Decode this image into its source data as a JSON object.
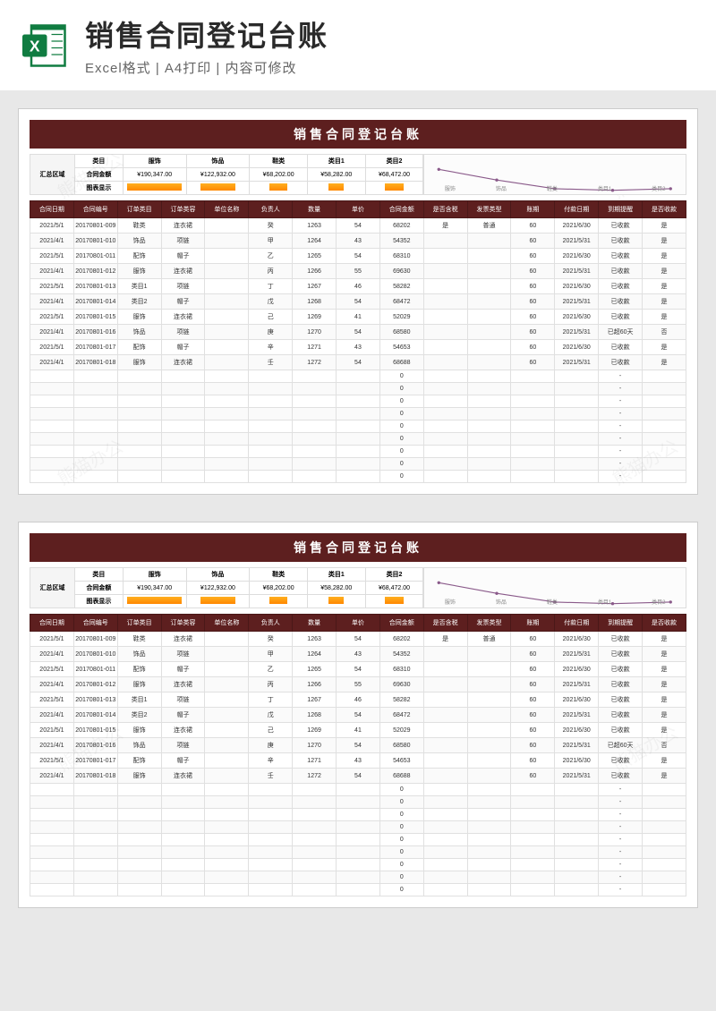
{
  "header": {
    "title": "销售合同登记台账",
    "subtitle": "Excel格式 | A4打印 | 内容可修改"
  },
  "sheet": {
    "title": "销售合同登记台账",
    "summary_label": "汇总区域",
    "summary_rows": [
      "类目",
      "合同金额",
      "图表显示"
    ],
    "categories": [
      {
        "name": "服饰",
        "amount": "¥190,347.00",
        "bar": 95
      },
      {
        "name": "饰品",
        "amount": "¥122,932.00",
        "bar": 62
      },
      {
        "name": "鞋类",
        "amount": "¥68,202.00",
        "bar": 35
      },
      {
        "name": "类目1",
        "amount": "¥58,282.00",
        "bar": 30
      },
      {
        "name": "类目2",
        "amount": "¥68,472.00",
        "bar": 35
      }
    ],
    "chart_labels": [
      "服饰",
      "饰品",
      "鞋类",
      "类目1",
      "类目2"
    ],
    "columns": [
      "合同日期",
      "合同编号",
      "订单类目",
      "订单类容",
      "单位名称",
      "负责人",
      "数量",
      "单价",
      "合同金额",
      "是否含税",
      "发票类型",
      "账期",
      "付款日期",
      "到期提醒",
      "是否收款"
    ],
    "rows": [
      [
        "2021/5/1",
        "20170801-009",
        "鞋类",
        "连衣裙",
        "",
        "癸",
        "1263",
        "54",
        "68202",
        "是",
        "普通",
        "60",
        "2021/6/30",
        "已收款",
        "是"
      ],
      [
        "2021/4/1",
        "20170801-010",
        "饰品",
        "项链",
        "",
        "甲",
        "1264",
        "43",
        "54352",
        "",
        "",
        "60",
        "2021/5/31",
        "已收款",
        "是"
      ],
      [
        "2021/5/1",
        "20170801-011",
        "配饰",
        "帽子",
        "",
        "乙",
        "1265",
        "54",
        "68310",
        "",
        "",
        "60",
        "2021/6/30",
        "已收款",
        "是"
      ],
      [
        "2021/4/1",
        "20170801-012",
        "服饰",
        "连衣裙",
        "",
        "丙",
        "1266",
        "55",
        "69630",
        "",
        "",
        "60",
        "2021/5/31",
        "已收款",
        "是"
      ],
      [
        "2021/5/1",
        "20170801-013",
        "类目1",
        "项链",
        "",
        "丁",
        "1267",
        "46",
        "58282",
        "",
        "",
        "60",
        "2021/6/30",
        "已收款",
        "是"
      ],
      [
        "2021/4/1",
        "20170801-014",
        "类目2",
        "帽子",
        "",
        "戊",
        "1268",
        "54",
        "68472",
        "",
        "",
        "60",
        "2021/5/31",
        "已收款",
        "是"
      ],
      [
        "2021/5/1",
        "20170801-015",
        "服饰",
        "连衣裙",
        "",
        "己",
        "1269",
        "41",
        "52029",
        "",
        "",
        "60",
        "2021/6/30",
        "已收款",
        "是"
      ],
      [
        "2021/4/1",
        "20170801-016",
        "饰品",
        "项链",
        "",
        "庚",
        "1270",
        "54",
        "68580",
        "",
        "",
        "60",
        "2021/5/31",
        "已超60天",
        "否"
      ],
      [
        "2021/5/1",
        "20170801-017",
        "配饰",
        "帽子",
        "",
        "辛",
        "1271",
        "43",
        "54653",
        "",
        "",
        "60",
        "2021/6/30",
        "已收款",
        "是"
      ],
      [
        "2021/4/1",
        "20170801-018",
        "服饰",
        "连衣裙",
        "",
        "壬",
        "1272",
        "54",
        "68688",
        "",
        "",
        "60",
        "2021/5/31",
        "已收款",
        "是"
      ],
      [
        "",
        "",
        "",
        "",
        "",
        "",
        "",
        "",
        "0",
        "",
        "",
        "",
        "",
        "-",
        ""
      ],
      [
        "",
        "",
        "",
        "",
        "",
        "",
        "",
        "",
        "0",
        "",
        "",
        "",
        "",
        "-",
        ""
      ],
      [
        "",
        "",
        "",
        "",
        "",
        "",
        "",
        "",
        "0",
        "",
        "",
        "",
        "",
        "-",
        ""
      ],
      [
        "",
        "",
        "",
        "",
        "",
        "",
        "",
        "",
        "0",
        "",
        "",
        "",
        "",
        "-",
        ""
      ],
      [
        "",
        "",
        "",
        "",
        "",
        "",
        "",
        "",
        "0",
        "",
        "",
        "",
        "",
        "-",
        ""
      ],
      [
        "",
        "",
        "",
        "",
        "",
        "",
        "",
        "",
        "0",
        "",
        "",
        "",
        "",
        "-",
        ""
      ],
      [
        "",
        "",
        "",
        "",
        "",
        "",
        "",
        "",
        "0",
        "",
        "",
        "",
        "",
        "-",
        ""
      ],
      [
        "",
        "",
        "",
        "",
        "",
        "",
        "",
        "",
        "0",
        "",
        "",
        "",
        "",
        "-",
        ""
      ],
      [
        "",
        "",
        "",
        "",
        "",
        "",
        "",
        "",
        "0",
        "",
        "",
        "",
        "",
        "-",
        ""
      ]
    ]
  },
  "chart_data": {
    "type": "bar",
    "title": "销售合同登记台账汇总",
    "categories": [
      "服饰",
      "饰品",
      "鞋类",
      "类目1",
      "类目2"
    ],
    "series": [
      {
        "name": "合同金额",
        "values": [
          190347,
          122932,
          68202,
          58282,
          68472
        ]
      }
    ],
    "xlabel": "类目",
    "ylabel": "合同金额",
    "ylim": [
      0,
      200000
    ],
    "secondary": {
      "type": "line",
      "categories": [
        "服饰",
        "饰品",
        "鞋类",
        "类目1",
        "类目2"
      ],
      "values": [
        190347,
        122932,
        68202,
        58282,
        68472
      ]
    }
  }
}
